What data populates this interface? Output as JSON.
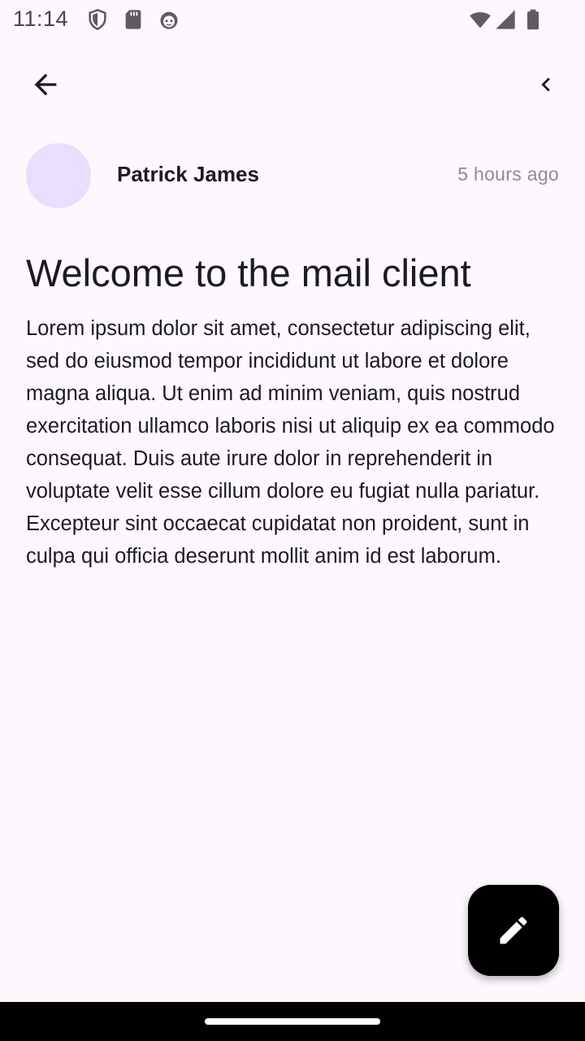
{
  "status_bar": {
    "time": "11:14",
    "icons": [
      "shield-icon",
      "sd-card-icon",
      "face-icon",
      "wifi-icon",
      "cell-signal-icon",
      "battery-icon"
    ]
  },
  "app_bar": {
    "back_icon": "arrow-back-icon",
    "collapse_icon": "chevron-left-icon"
  },
  "email": {
    "sender": "Patrick James",
    "time_ago": "5 hours ago",
    "subject": "Welcome to the mail client",
    "body": "Lorem ipsum dolor sit amet, consectetur adipiscing elit, sed do eiusmod tempor incididunt ut labore et dolore magna aliqua. Ut enim ad minim veniam, quis nostrud exercitation ullamco laboris nisi ut aliquip ex ea commodo consequat. Duis aute irure dolor in reprehenderit in voluptate velit esse cillum dolore eu fugiat nulla pariatur. Excepteur sint occaecat cupidatat non proident, sunt in culpa qui officia deserunt mollit anim id est laborum."
  },
  "fab": {
    "icon": "edit-icon"
  },
  "colors": {
    "background": "#fdf7fe",
    "avatar": "#e8defe",
    "fab": "#000000",
    "text_primary": "#1c1b1f",
    "text_secondary": "#8e8a93"
  }
}
